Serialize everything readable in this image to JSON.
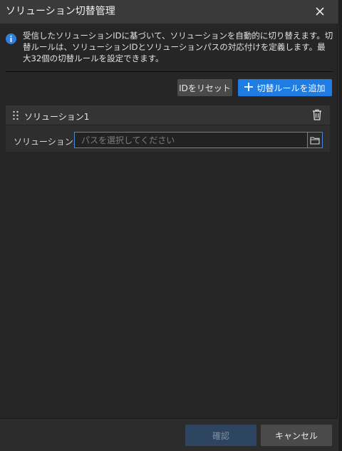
{
  "dialog": {
    "title": "ソリューション切替管理",
    "close_icon": "close-icon"
  },
  "info": {
    "icon": "info-icon",
    "text": "受信したソリューションIDに基づいて、ソリューションを自動的に切り替えます。切替ルールは、ソリューションIDとソリューションパスの対応付けを定義します。最大32個の切替ルールを設定できます。"
  },
  "toolbar": {
    "reset_label": "IDをリセット",
    "add_label": "切替ルールを追加",
    "add_icon": "plus-icon"
  },
  "rules": [
    {
      "title": "ソリューション1",
      "path_label": "ソリューションパス",
      "path_value": "",
      "path_placeholder": "パスを選択してください"
    }
  ],
  "footer": {
    "ok_label": "確認",
    "cancel_label": "キャンセル"
  },
  "colors": {
    "accent": "#1f7ce3",
    "title_bar": "#3a3a3a",
    "background": "#262626",
    "disabled_button": "#2d4560"
  }
}
